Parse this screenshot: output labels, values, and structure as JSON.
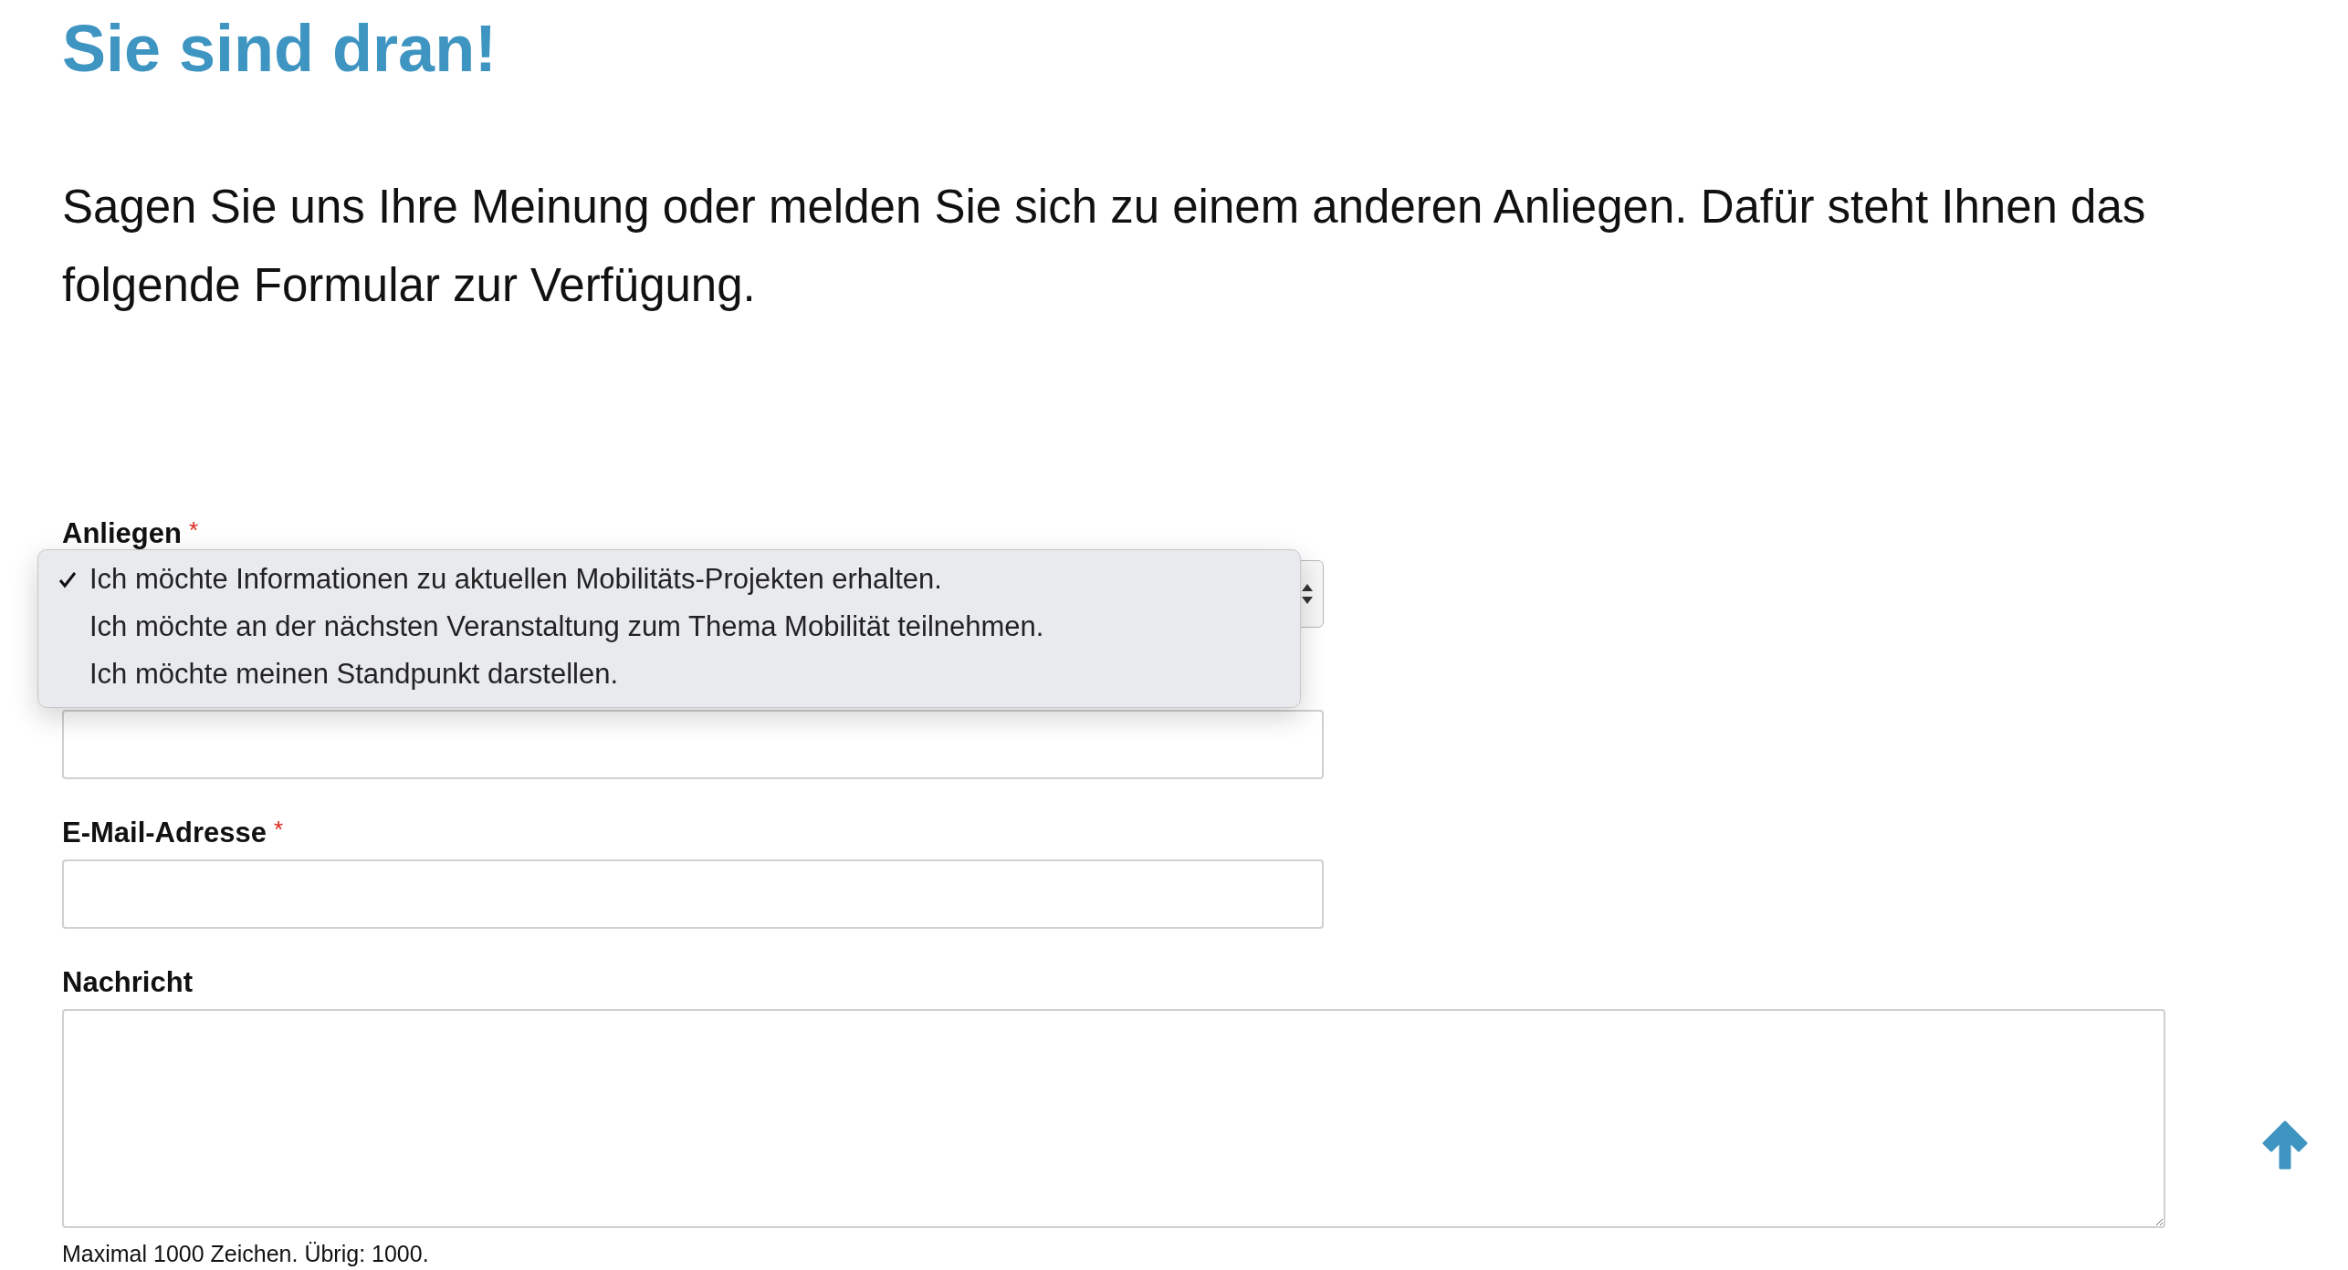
{
  "heading": "Sie sind dran!",
  "intro": "Sagen Sie uns Ihre Meinung oder melden Sie sich zu einem anderen Anliegen. Dafür steht Ihnen das folgende Formular zur Verfügung.",
  "form": {
    "fields": [
      {
        "kind": "select",
        "label": "Anliegen",
        "required_mark": "*",
        "expanded": true,
        "options": [
          {
            "label": "Ich möchte Informationen zu aktuellen Mobilitäts-Projekten erhalten.",
            "selected": true
          },
          {
            "label": "Ich möchte an der nächsten Veranstaltung zum Thema Mobilität teilnehmen.",
            "selected": false
          },
          {
            "label": "Ich möchte meinen Standpunkt darstellen.",
            "selected": false
          }
        ]
      },
      {
        "kind": "input"
      },
      {
        "kind": "input",
        "label": "E-Mail-Adresse",
        "required_mark": "*"
      },
      {
        "kind": "textarea",
        "label": "Nachricht",
        "hint": "Maximal 1000 Zeichen. Übrig: 1000."
      }
    ]
  }
}
